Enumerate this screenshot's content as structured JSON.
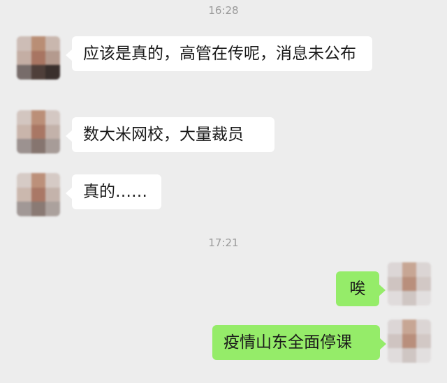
{
  "chat": {
    "time_1": "16:28",
    "time_2": "17:21",
    "messages": [
      {
        "side": "in",
        "text": "应该是真的，高管在传呢，消息未公布"
      },
      {
        "side": "in",
        "text": "数大米网校，大量裁员"
      },
      {
        "side": "in",
        "text": "真的……"
      },
      {
        "side": "out",
        "text": "唉"
      },
      {
        "side": "out",
        "text": "疫情山东全面停课"
      }
    ]
  },
  "colors": {
    "background": "#ededed",
    "incoming_bubble": "#ffffff",
    "outgoing_bubble": "#95ec69",
    "timestamp_text": "#9a9a9a"
  }
}
